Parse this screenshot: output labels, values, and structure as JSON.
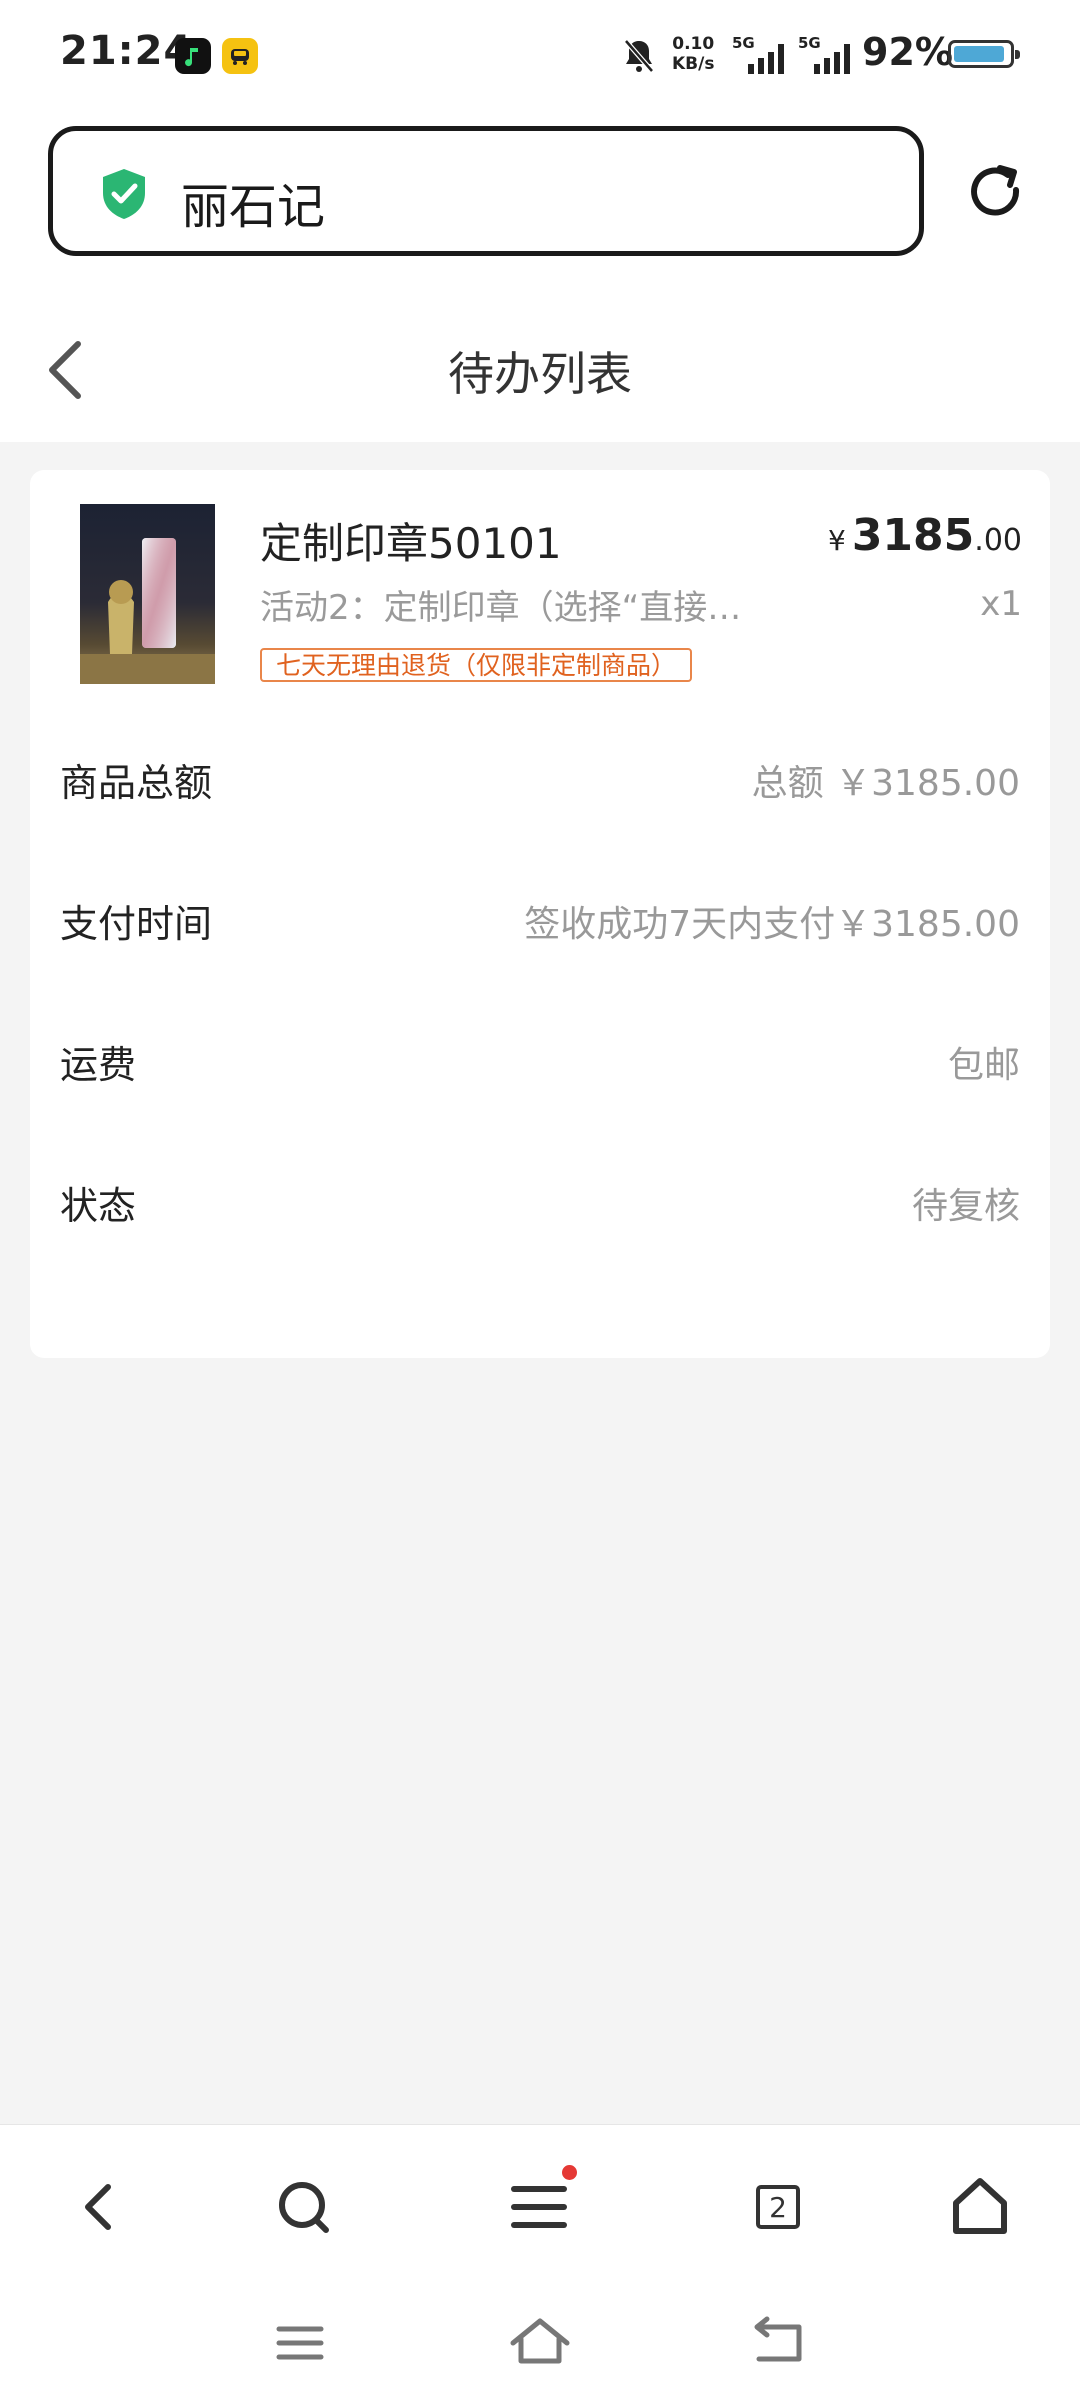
{
  "status_bar": {
    "time": "21:24",
    "net_speed_value": "0.10",
    "net_speed_unit": "KB/s",
    "signal1_label": "5G",
    "signal2_label": "5G",
    "battery_percent": "92%",
    "battery_level": 0.92,
    "icons": [
      "app-icon-music",
      "app-icon-taxi",
      "bell-muted-icon",
      "signal-icon",
      "battery-icon"
    ]
  },
  "address_bar": {
    "site_name": "丽石记",
    "secure_icon": "shield-check-icon",
    "refresh_icon": "refresh-icon"
  },
  "header": {
    "title": "待办列表",
    "back_icon": "chevron-left-icon"
  },
  "order": {
    "product": {
      "name": "定制印章50101",
      "description": "活动2：定制印章（选择“直接…",
      "badge": "七天无理由退货（仅限非定制商品）",
      "price_symbol": "¥",
      "price_int": "3185",
      "price_dec": ".00",
      "quantity": "x1"
    },
    "details": [
      {
        "label": "商品总额",
        "value": "总额 ￥3185.00"
      },
      {
        "label": "支付时间",
        "value": "签收成功7天内支付￥3185.00"
      },
      {
        "label": "运费",
        "value": "包邮"
      },
      {
        "label": "状态",
        "value": "待复核"
      }
    ]
  },
  "browser_bar": {
    "tab_count": "2",
    "buttons": [
      "back-icon",
      "search-icon",
      "menu-icon",
      "tabs-icon",
      "home-icon"
    ]
  },
  "system_nav": {
    "buttons": [
      "recents-icon",
      "home-icon",
      "back-icon"
    ]
  },
  "colors": {
    "accent_green": "#2bb673",
    "badge_orange": "#e0621f",
    "notification_red": "#e53935",
    "battery_blue": "#4ea8d6"
  }
}
